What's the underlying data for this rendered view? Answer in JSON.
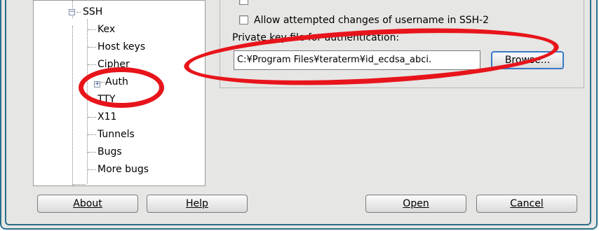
{
  "tree": {
    "nodes": [
      {
        "label": "SSH"
      },
      {
        "label": "Kex"
      },
      {
        "label": "Host keys"
      },
      {
        "label": "Cipher"
      },
      {
        "label": "Auth"
      },
      {
        "label": "TTY"
      },
      {
        "label": "X11"
      },
      {
        "label": "Tunnels"
      },
      {
        "label": "Bugs"
      },
      {
        "label": "More bugs"
      }
    ],
    "collapse_symbol": "−",
    "expand_symbol": "+"
  },
  "settings": {
    "allow_username_change_label": "Allow attempted changes of username in SSH-2",
    "private_key_label": "Private key file for authentication:",
    "private_key_label_access_key": "k",
    "private_key_path": "C:¥Program Files¥teraterm¥id_ecdsa_abci.",
    "browse_label": "Browse..."
  },
  "buttons": {
    "about": {
      "label": "About",
      "access_key": "A"
    },
    "help": {
      "label": "Help",
      "access_key": "H"
    },
    "open": {
      "label": "Open",
      "access_key": "O"
    },
    "cancel": {
      "label": "Cancel",
      "access_key": "C"
    }
  },
  "colors": {
    "annotation_red": "#e8141b",
    "frame_teal": "#2a6f8d",
    "focus_blue": "#3a78c8"
  }
}
